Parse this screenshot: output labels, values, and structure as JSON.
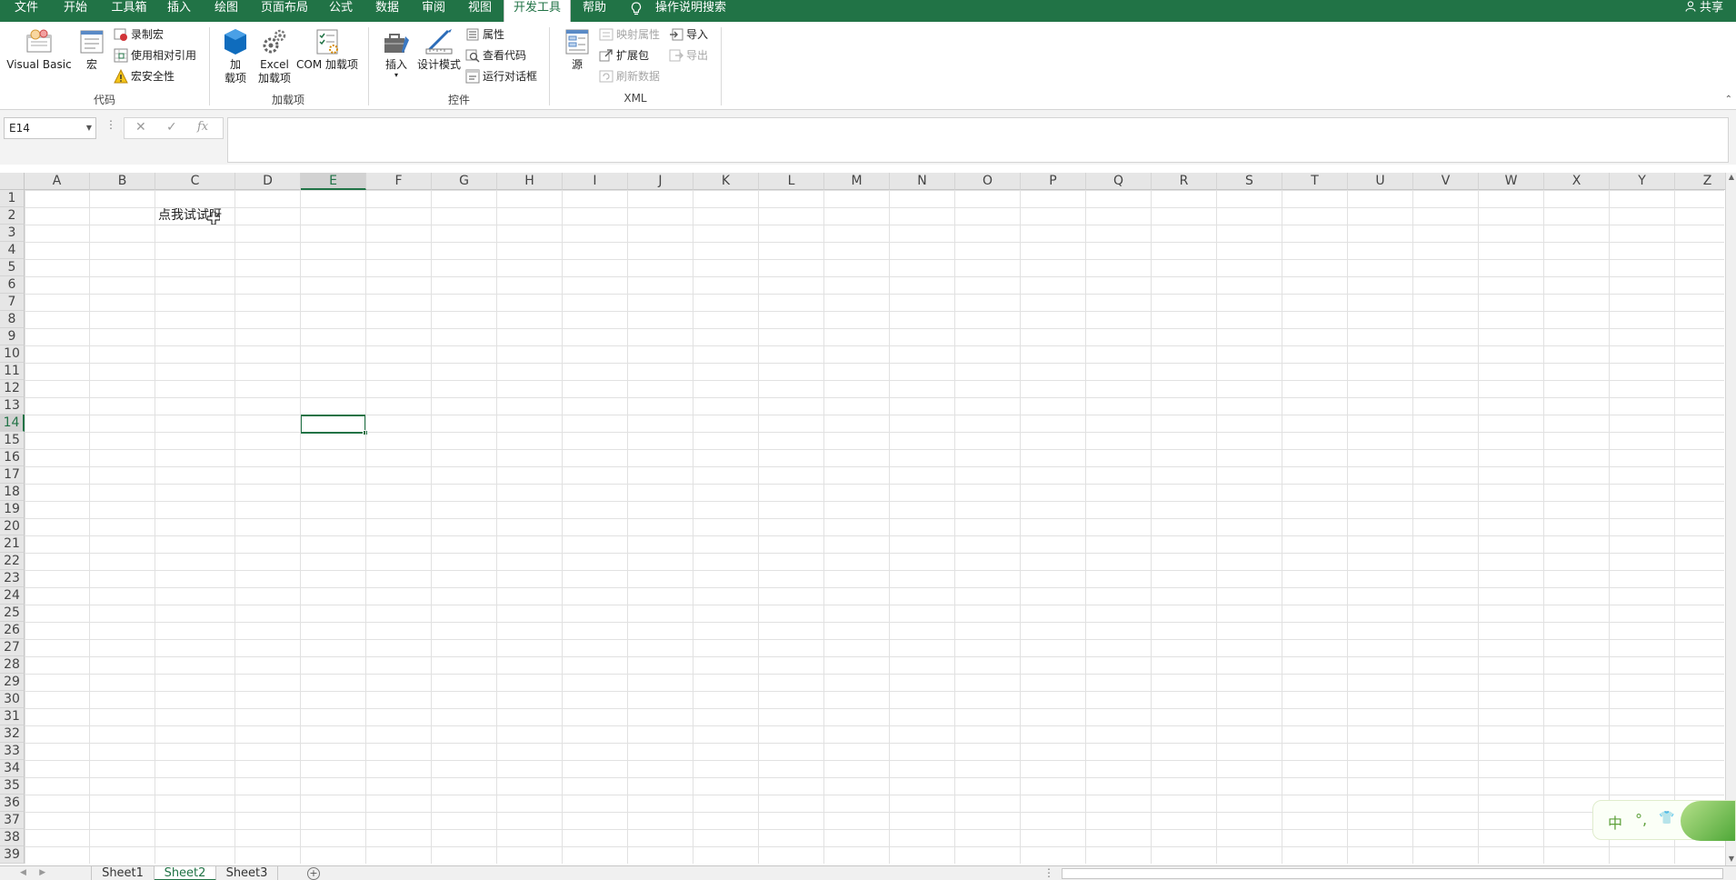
{
  "tabs": [
    {
      "label": "文件",
      "active": false
    },
    {
      "label": "开始",
      "active": false
    },
    {
      "label": "工具箱",
      "active": false
    },
    {
      "label": "插入",
      "active": false
    },
    {
      "label": "绘图",
      "active": false
    },
    {
      "label": "页面布局",
      "active": false
    },
    {
      "label": "公式",
      "active": false
    },
    {
      "label": "数据",
      "active": false
    },
    {
      "label": "审阅",
      "active": false
    },
    {
      "label": "视图",
      "active": false
    },
    {
      "label": "开发工具",
      "active": true
    },
    {
      "label": "帮助",
      "active": false
    }
  ],
  "search_label": "操作说明搜索",
  "share_label": "共享",
  "ribbon": {
    "code": {
      "group_label": "代码",
      "visual_basic": "Visual Basic",
      "macros": "宏",
      "record_macro": "录制宏",
      "relative_ref": "使用相对引用",
      "macro_security": "宏安全性"
    },
    "addins": {
      "group_label": "加载项",
      "addins_line1": "加",
      "addins_line2": "载项",
      "excel_line1": "Excel",
      "excel_line2": "加载项",
      "com_addins": "COM 加载项"
    },
    "controls": {
      "group_label": "控件",
      "insert": "插入",
      "insert_arrow": "▾",
      "design_mode": "设计模式",
      "properties": "属性",
      "view_code": "查看代码",
      "run_dialog": "运行对话框"
    },
    "xml": {
      "group_label": "XML",
      "source": "源",
      "map_properties": "映射属性",
      "expansion_packs": "扩展包",
      "refresh_data": "刷新数据",
      "import": "导入",
      "export": "导出"
    }
  },
  "formula_bar": {
    "name_box": "E14",
    "cancel": "✕",
    "enter": "✓",
    "fx": "fx",
    "formula": ""
  },
  "columns": [
    "A",
    "B",
    "C",
    "D",
    "E",
    "F",
    "G",
    "H",
    "I",
    "J",
    "K",
    "L",
    "M",
    "N",
    "O",
    "P",
    "Q",
    "R",
    "S",
    "T",
    "U",
    "V",
    "W",
    "X",
    "Y",
    "Z"
  ],
  "selected_column": "E",
  "rows": [
    "1",
    "2",
    "3",
    "4",
    "5",
    "6",
    "7",
    "8",
    "9",
    "10",
    "11",
    "12",
    "13",
    "14",
    "15",
    "16",
    "17",
    "18",
    "19",
    "20",
    "21",
    "22",
    "23",
    "24",
    "25",
    "26",
    "27",
    "28",
    "29",
    "30",
    "31",
    "32",
    "33",
    "34",
    "35",
    "36",
    "37",
    "38",
    "39"
  ],
  "selected_row": "14",
  "cell_c2": "点我试试呀",
  "sheets": [
    {
      "label": "Sheet1",
      "active": false
    },
    {
      "label": "Sheet2",
      "active": true
    },
    {
      "label": "Sheet3",
      "active": false
    }
  ],
  "add_sheet": "+",
  "ime": {
    "mode": "中",
    "punct": "°,",
    "skin": "👕"
  },
  "colors": {
    "accent": "#217346",
    "header_bg": "#e6e6e6",
    "gridline": "#e1e1e1"
  }
}
